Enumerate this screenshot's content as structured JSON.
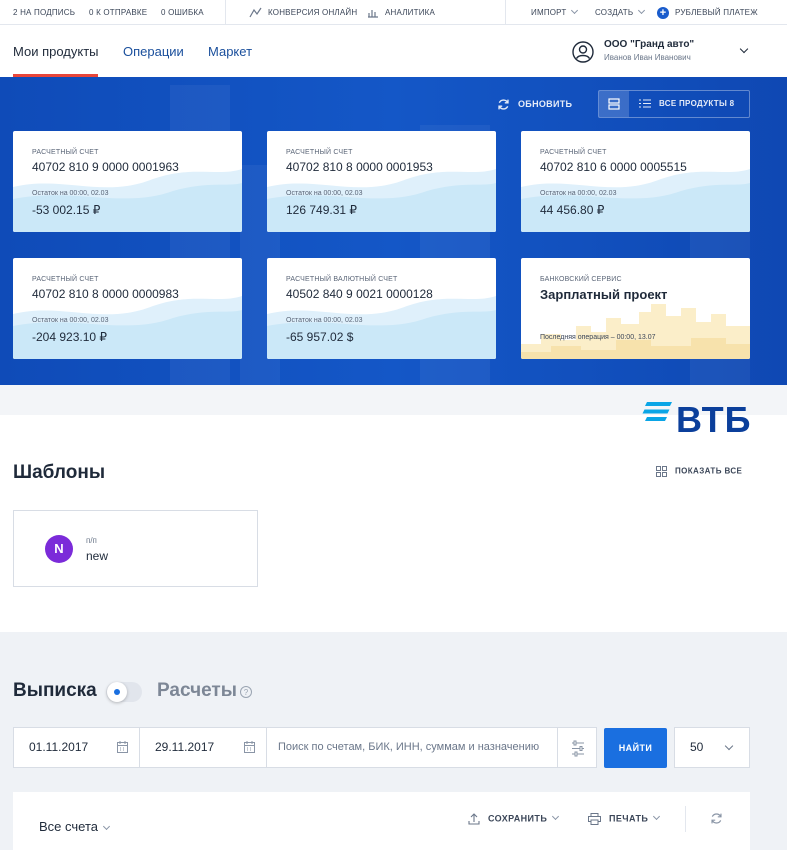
{
  "topbar": {
    "to_sign": "2 НА ПОДПИСЬ",
    "to_send": "0 К ОТПРАВКЕ",
    "errors": "0 ОШИБКА",
    "conversion": "КОНВЕРСИЯ ОНЛАЙН",
    "analytics": "АНАЛИТИКА",
    "import": "ИМПОРТ",
    "create": "СОЗДАТЬ",
    "ruble_payment": "РУБЛЕВЫЙ ПЛАТЕЖ"
  },
  "nav": {
    "tabs": [
      "Мои продукты",
      "Операции",
      "Маркет"
    ],
    "org_name": "ООО \"Гранд авто\"",
    "org_user": "Иванов Иван Иванович"
  },
  "hero": {
    "refresh_label": "ОБНОВИТЬ",
    "all_products_label": "ВСЕ ПРОДУКТЫ 8"
  },
  "cards": [
    {
      "label": "РАСЧЕТНЫЙ СЧЕТ",
      "number": "40702 810 9 0000 0001963",
      "caption": "Остаток на 00:00, 02.03",
      "amount": "-53 002.15 ₽"
    },
    {
      "label": "РАСЧЕТНЫЙ СЧЕТ",
      "number": "40702 810 8 0000 0001953",
      "caption": "Остаток на 00:00, 02.03",
      "amount": "126 749.31 ₽"
    },
    {
      "label": "РАСЧЕТНЫЙ СЧЕТ",
      "number": "40702 810 6 0000 0005515",
      "caption": "Остаток на 00:00, 02.03",
      "amount": "44 456.80 ₽"
    },
    {
      "label": "РАСЧЕТНЫЙ СЧЕТ",
      "number": "40702 810 8 0000 0000983",
      "caption": "Остаток на 00:00, 02.03",
      "amount": "-204 923.10 ₽"
    },
    {
      "label": "РАСЧЕТНЫЙ ВАЛЮТНЫЙ СЧЕТ",
      "number": "40502 840 9 0021 0000128",
      "caption": "Остаток на 00:00, 02.03",
      "amount": "-65 957.02 $"
    }
  ],
  "service_card": {
    "label": "БАНКОВСКИЙ СЕРВИС",
    "title": "Зарплатный проект",
    "last_op": "Последняя операция – 00:00, 13.07"
  },
  "brand": {
    "logo_text": "ВТБ",
    "color": "#0b3f9b"
  },
  "templates": {
    "title": "Шаблоны",
    "show_all": "ПОКАЗАТЬ ВСЕ",
    "item": {
      "avatar": "N",
      "type": "п/п",
      "name": "new"
    }
  },
  "statement": {
    "title": "Выписка",
    "alt_title": "Расчеты",
    "help": "?",
    "date_from": "01.11.2017",
    "date_to": "29.11.2017",
    "search_placeholder": "Поиск по счетам, БИК, ИНН, суммам и назначению",
    "find_label": "НАЙТИ",
    "per_page": "50",
    "accounts_label": "Все счета",
    "save_label": "СОХРАНИТЬ",
    "print_label": "ПЕЧАТЬ"
  },
  "colors": {
    "accent": "#1a6fe0",
    "hero": "#1457c7",
    "active_tab": "#e8463a"
  }
}
